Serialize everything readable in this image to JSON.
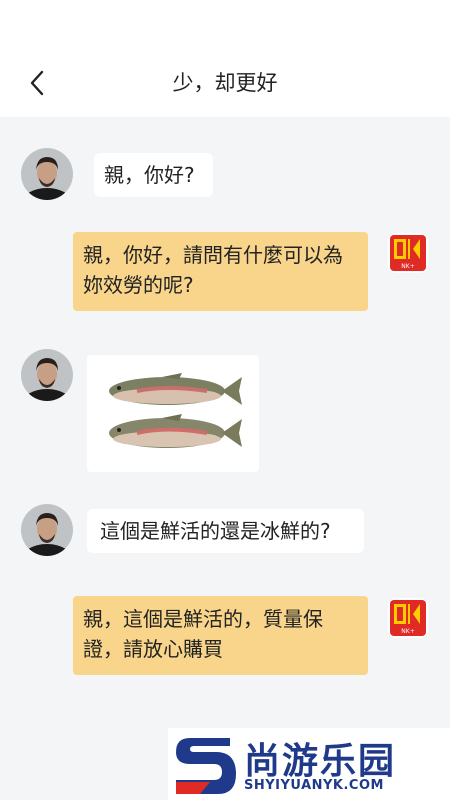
{
  "header": {
    "back_icon": "chevron-left-icon",
    "title": "少，却更好"
  },
  "messages": [
    {
      "sender": "customer",
      "text": "親，你好?"
    },
    {
      "sender": "shop",
      "text": "親，你好，請問有什麼可以為妳效勞的呢?"
    },
    {
      "sender": "customer",
      "type": "image",
      "content": "two trout fish"
    },
    {
      "sender": "customer",
      "text": "這個是鮮活的還是冰鮮的?"
    },
    {
      "sender": "shop",
      "text": "親，這個是鮮活的，質量保證，請放心購買"
    }
  ],
  "shop_logo": {
    "letters": "NK",
    "sub": "NK+",
    "color": "#e02a26",
    "accent": "#ffcc00"
  },
  "watermark": {
    "name": "尚游乐园",
    "url": "SHYIYUANYK.COM",
    "color": "#1f3a8a"
  }
}
